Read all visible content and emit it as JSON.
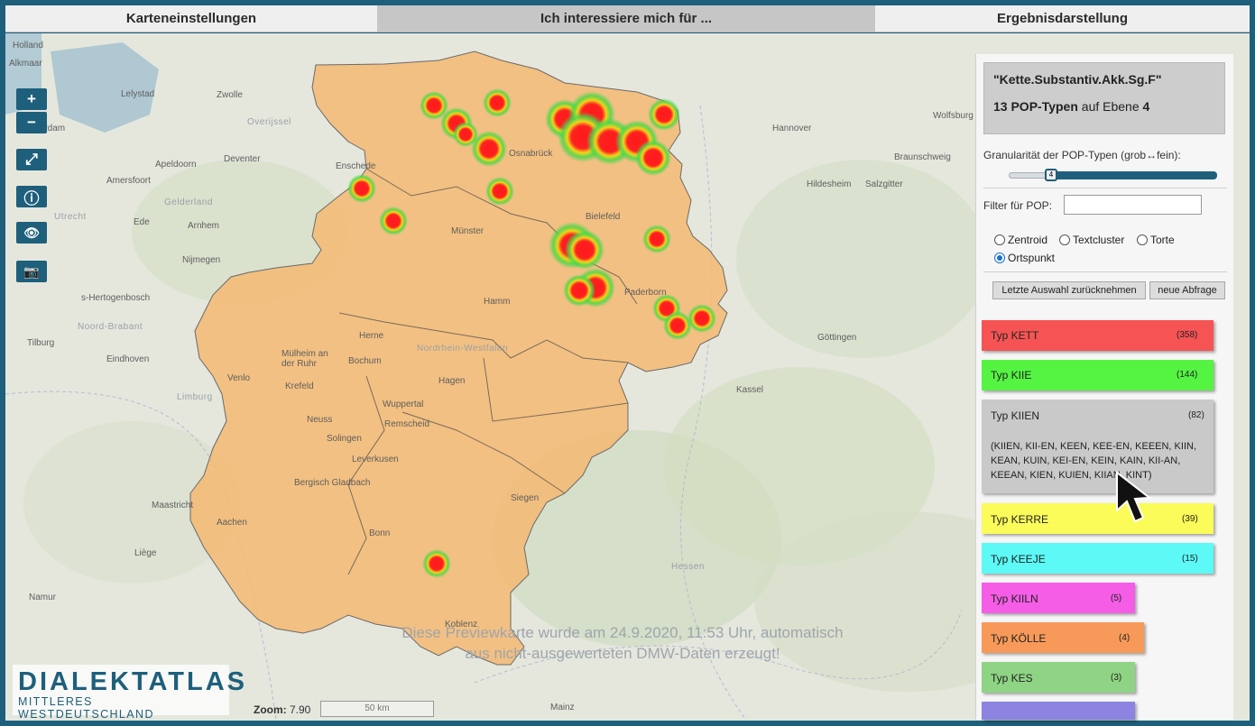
{
  "tabs": [
    {
      "label": "Karteneinstellungen"
    },
    {
      "label": "Ich interessiere mich für ..."
    },
    {
      "label": "Ergebnisdarstellung"
    }
  ],
  "map": {
    "controls": {
      "zoom_in": "+",
      "zoom_out": "−",
      "fullscreen": "⤢",
      "info": "ⓘ",
      "eye": "👁",
      "camera": "📷"
    },
    "cities": [
      "Holland",
      "Alkmaar",
      "Lelystad",
      "Zwolle",
      "sterdam",
      "Overijssel",
      "Apeldoorn",
      "Deventer",
      "Amersfoort",
      "Enschede",
      "Utrecht",
      "Gelderland",
      "Ede",
      "Arnhem",
      "Nijmegen",
      "s-Hertogenbosch",
      "Noord-Brabant",
      "Tilburg",
      "Eindhoven",
      "Venlo",
      "Limburg",
      "Maastricht",
      "Liège",
      "Namur",
      "Osnabrück",
      "Münster",
      "Bielefeld",
      "Paderborn",
      "Hamm",
      "Herne",
      "Bochum",
      "Mülheim an der Ruhr",
      "Krefeld",
      "Wuppertal",
      "Hagen",
      "Remscheid",
      "Neuss",
      "Solingen",
      "Leverkusen",
      "Bergisch Gladbach",
      "Aachen",
      "Bonn",
      "Siegen",
      "Koblenz",
      "Hannover",
      "Wolfsburg",
      "Braunschweig",
      "Salzgitter",
      "Hildesheim",
      "Göttingen",
      "Kassel",
      "Hessen",
      "Mainz",
      "Nordrhein-Westfalen"
    ],
    "preview_line1": "Diese Previewkarte wurde am 24.9.2020, 11:53 Uhr, automatisch",
    "preview_line2": "aus nicht-ausgewerteten DMW-Daten erzeugt!",
    "zoom_label": "Zoom:",
    "zoom_value": "7.90",
    "scale_label": "50 km"
  },
  "logo": {
    "line1": "DIALEKTATLAS",
    "line2": "MITTLERES WESTDEUTSCHLAND"
  },
  "panel": {
    "query": "\"Kette.Substantiv.Akk.Sg.F\"",
    "pop_count": "13",
    "pop_label": "POP-Typen",
    "level_text": "auf Ebene",
    "level": "4",
    "granularity_label": "Granularität der POP-Typen (grob↔fein):",
    "slider_value": "4",
    "filter_label": "Filter für POP:",
    "filter_value": "",
    "radios": [
      {
        "label": "Zentroid",
        "checked": false
      },
      {
        "label": "Textcluster",
        "checked": false
      },
      {
        "label": "Torte",
        "checked": false
      },
      {
        "label": "Ortspunkt",
        "checked": true
      }
    ],
    "undo_button": "Letzte Auswahl zurücknehmen",
    "new_query_button": "neue Abfrage"
  },
  "types": [
    {
      "label": "Typ KETT",
      "count": "(358)",
      "color": "#f65454"
    },
    {
      "label": "Typ KIIE",
      "count": "(144)",
      "color": "#55f443"
    },
    {
      "label": "Typ KIIEN",
      "count": "(82)",
      "color": "#c9c9c9",
      "details": "(KIIEN, KII-EN, KEEN, KEE-EN, KEEEN, KIIN, KEAN, KUIN, KEI-EN, KEIN, KAIN, KII-AN, KEEAN, KIEN, KUIEN, KIIAN, KINT)"
    },
    {
      "label": "Typ KERRE",
      "count": "(39)",
      "color": "#fbfb5a"
    },
    {
      "label": "Typ KEEJE",
      "count": "(15)",
      "color": "#5cf9f6"
    },
    {
      "label": "Typ KIILN",
      "count": "(5)",
      "color": "#f55de6"
    },
    {
      "label": "Typ KÖLLE",
      "count": "(4)",
      "color": "#f79a59"
    },
    {
      "label": "Typ KES",
      "count": "(3)",
      "color": "#8fd484"
    },
    {
      "label": "",
      "count": "",
      "color": "#8c84e0"
    }
  ]
}
